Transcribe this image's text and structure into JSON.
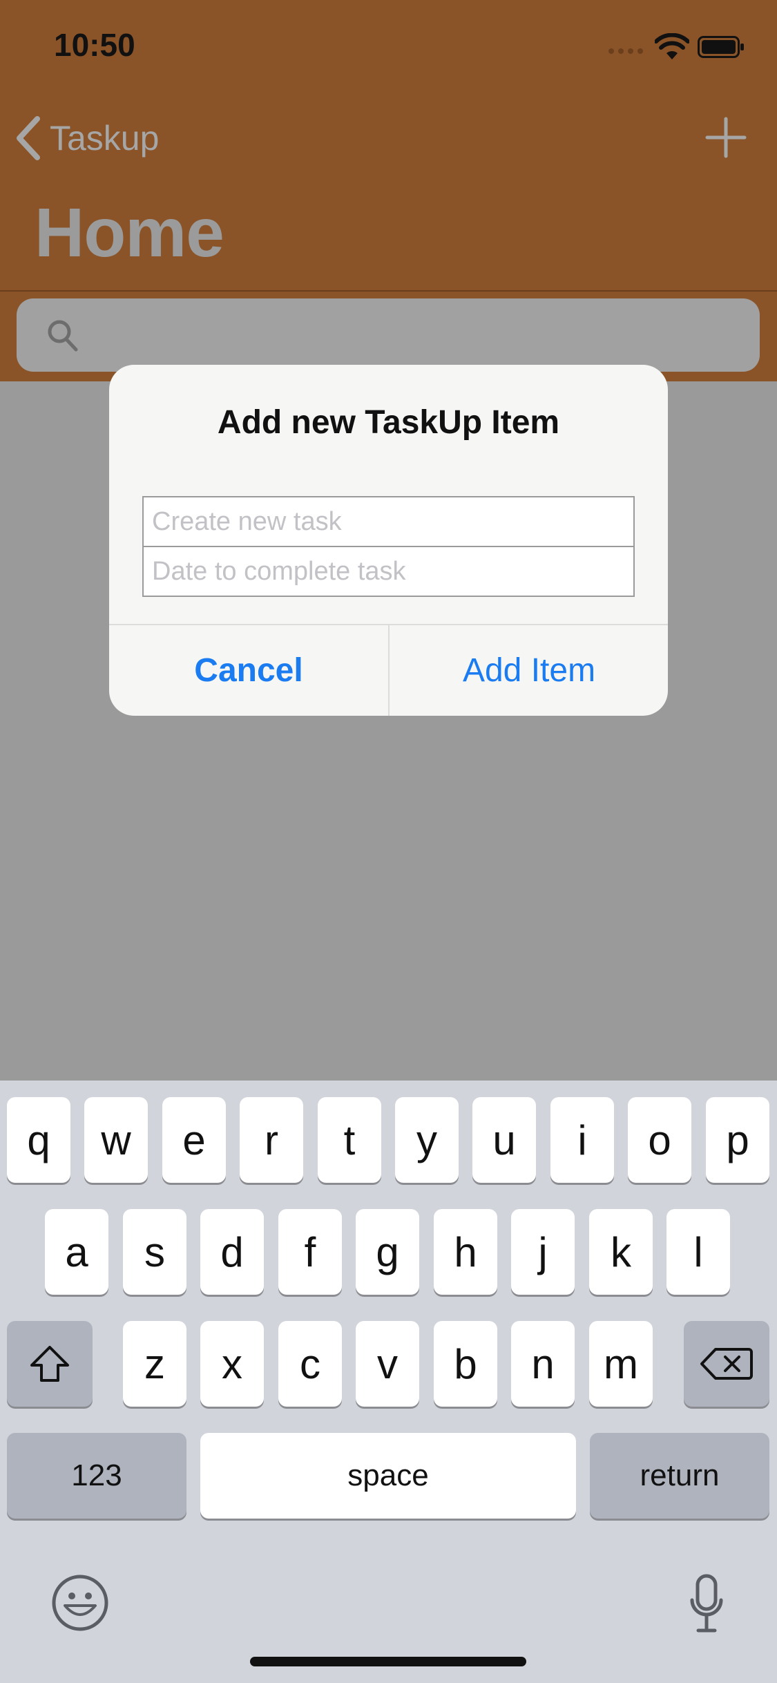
{
  "status_bar": {
    "time": "10:50"
  },
  "nav": {
    "back_label": "Taskup",
    "title": "Home"
  },
  "search": {
    "placeholder": ""
  },
  "dialog": {
    "title": "Add new TaskUp Item",
    "task_placeholder": "Create new task",
    "date_placeholder": "Date to complete task",
    "cancel_label": "Cancel",
    "add_label": "Add Item"
  },
  "keyboard": {
    "row1": [
      "q",
      "w",
      "e",
      "r",
      "t",
      "y",
      "u",
      "i",
      "o",
      "p"
    ],
    "row2": [
      "a",
      "s",
      "d",
      "f",
      "g",
      "h",
      "j",
      "k",
      "l"
    ],
    "row3": [
      "z",
      "x",
      "c",
      "v",
      "b",
      "n",
      "m"
    ],
    "numbers_label": "123",
    "space_label": "space",
    "return_label": "return"
  },
  "colors": {
    "header": "#8a5428",
    "accent": "#1a7cf0",
    "dim": "#9a9a9a"
  },
  "icons": [
    "signal-icon",
    "wifi-icon",
    "battery-icon",
    "back-chevron-icon",
    "plus-icon",
    "search-icon",
    "shift-icon",
    "delete-icon",
    "emoji-icon",
    "mic-icon"
  ]
}
